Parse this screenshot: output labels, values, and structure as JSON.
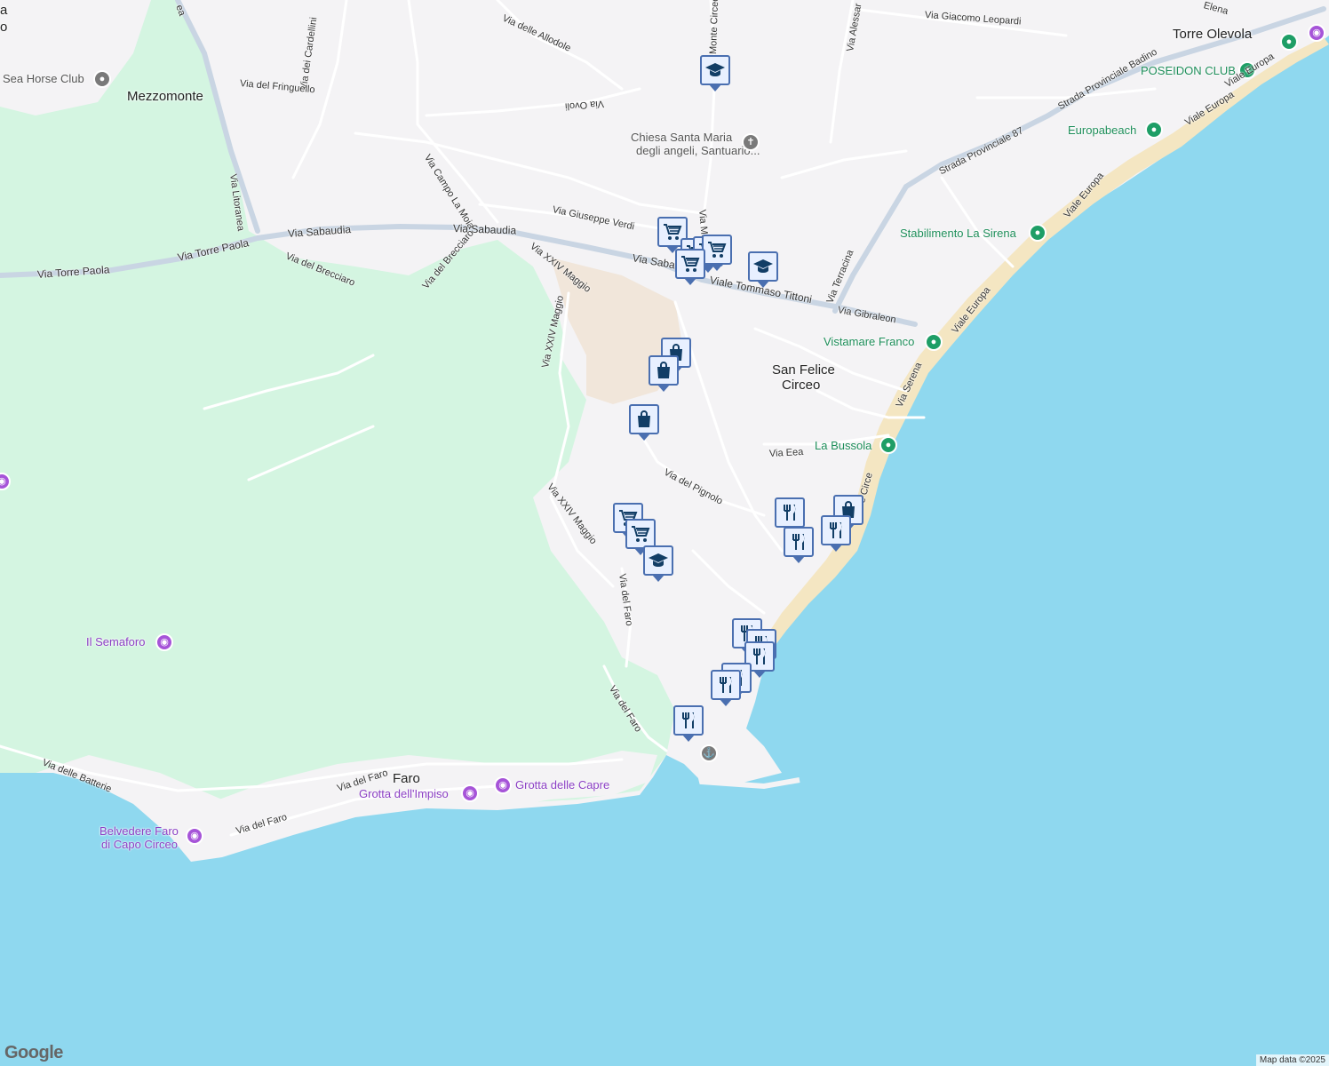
{
  "colors": {
    "water": "#8fd8ef",
    "park": "#d4f5e1",
    "land": "#f4f3f5",
    "beach": "#f4e6c2",
    "road": "#ffffff",
    "road_major": "#c9d5e3"
  },
  "places": {
    "mezzomonte": "Mezzomonte",
    "san_felice_1": "San Felice",
    "san_felice_2": "Circeo",
    "torre_olevola": "Torre Olevola",
    "faro": "Faro"
  },
  "pois": {
    "sea_horse": "Sea Horse Club",
    "chiesa_1": "Chiesa Santa Maria",
    "chiesa_2": "degli angeli, Santuario...",
    "poseidon": "POSEIDON CLUB",
    "europabeach": "Europabeach",
    "la_sirena": "Stabilimento La Sirena",
    "vistamare": "Vistamare Franco",
    "la_bussola": "La Bussola",
    "semaforo": "Il Semaforo",
    "belvedere_1": "Belvedere Faro",
    "belvedere_2": "di Capo Circeo",
    "grotta_impiso": "Grotta dell'Impiso",
    "grotta_capre": "Grotta delle Capre"
  },
  "roads": {
    "allodole": "Via delle Allodole",
    "cardellini": "Via dei Cardellini",
    "monte_circeo": "Monte Circeo",
    "alessandro": "Via Alessar",
    "leopardi": "Via Giacomo Leopardi",
    "elena": "Elena",
    "badino": "Strada Provinciale Badino",
    "fringuello": "Via del Fringuello",
    "ovoli": "Via Ovoli",
    "sp87": "Strada Provinciale 87",
    "viale_europa": "Viale Europa",
    "campo_la_moia": "Via Campo La Moia",
    "litoranea": "Via Litoranea",
    "verdi": "Via Giuseppe Verdi",
    "sabaudia_1": "Via Sabaudia",
    "sabaudia_2": "Via Sabaudia",
    "sabaudia_3": "Via Saba",
    "torre_paola_1": "Via Torre Paola",
    "torre_paola_2": "Via Torre Paola",
    "brecciaro_1": "Via del Brecciaro",
    "brecciaro_2": "Via del Brecciaro",
    "xxiv_1": "Via XXIV Maggio",
    "xxiv_2": "Via XXIV Maggio",
    "xxiv_3": "Via XXIV Maggio",
    "tittoni": "Viale Tommaso Tittoni",
    "terracina": "Via Terracina",
    "gibraleon": "Via Gibraleon",
    "mo": "Via Mo",
    "serena": "Via Serena",
    "eea": "Via Eea",
    "pignolo": "Via del Pignolo",
    "circe": "e Circe",
    "faro_1": "Via del Faro",
    "faro_2": "Via del Faro",
    "faro_3": "Via del Faro",
    "faro_4": "Via del Faro",
    "batterie": "Via delle Batterie",
    "ea": "ea",
    "a": "a",
    "o": "o"
  },
  "markers": [
    {
      "icon": "school-icon"
    },
    {
      "icon": "cart-icon"
    },
    {
      "icon": "cart-icon"
    },
    {
      "icon": "cart-icon"
    },
    {
      "icon": "cart-icon"
    },
    {
      "icon": "cart-icon"
    },
    {
      "icon": "school-icon"
    },
    {
      "icon": "bag-icon"
    },
    {
      "icon": "bag-icon"
    },
    {
      "icon": "bag-icon"
    },
    {
      "icon": "cart-icon"
    },
    {
      "icon": "cart-icon"
    },
    {
      "icon": "school-icon"
    },
    {
      "icon": "fork-knife-icon"
    },
    {
      "icon": "bag-icon"
    },
    {
      "icon": "fork-knife-icon"
    },
    {
      "icon": "fork-knife-icon"
    },
    {
      "icon": "fork-knife-icon"
    },
    {
      "icon": "fork-knife-icon"
    },
    {
      "icon": "fork-knife-icon"
    },
    {
      "icon": "fork-knife-icon"
    },
    {
      "icon": "fork-knife-icon"
    },
    {
      "icon": "fork-knife-icon"
    }
  ],
  "footer": {
    "logo": "Google",
    "attribution": "Map data ©2025"
  }
}
